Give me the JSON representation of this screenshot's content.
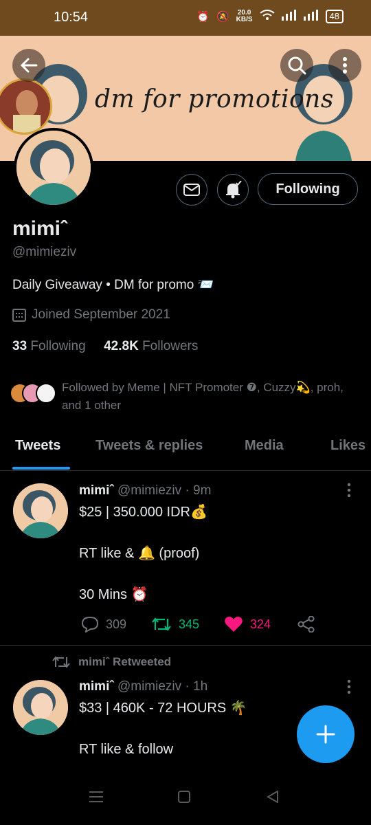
{
  "status_bar": {
    "time": "10:54",
    "net_speed_value": "20.0",
    "net_speed_unit": "KB/S",
    "battery": "48"
  },
  "banner": {
    "text": "dm for promotions"
  },
  "header_icons": {
    "back": "back-arrow-icon",
    "search": "search-icon",
    "more": "more-vertical-icon"
  },
  "profile": {
    "display_name": "mimiˆ",
    "handle": "@mimieziv",
    "bio": "Daily Giveaway • DM for promo 📨",
    "joined": "Joined September 2021",
    "following_count": "33",
    "following_label": "Following",
    "followers_count": "42.8K",
    "followers_label": "Followers",
    "followed_by": "Followed by Meme | NFT Promoter ❼, Cuzzy💫, proh, and 1 other",
    "follow_button": "Following"
  },
  "tabs": [
    {
      "label": "Tweets",
      "active": true
    },
    {
      "label": "Tweets & replies"
    },
    {
      "label": "Media"
    },
    {
      "label": "Likes"
    }
  ],
  "tweets": [
    {
      "name": "mimiˆ",
      "meta": "@mimieziv · 9m",
      "lines": [
        "$25 |  350.000 IDR💰",
        "RT like & 🔔 (proof)",
        "30 Mins ⏰"
      ],
      "replies": "309",
      "retweets": "345",
      "likes": "324"
    },
    {
      "retweet_label": "mimiˆ Retweeted",
      "name": "mimiˆ",
      "meta": "@mimieziv · 1h",
      "lines": [
        "$33 | 460K - 72 HOURS 🌴",
        "RT like & follow"
      ]
    }
  ],
  "colors": {
    "accent": "#1d9bf0",
    "retweet": "#00ba7c",
    "like": "#f91880",
    "banner": "#f2c8a6",
    "statusbar": "#6f4a1f"
  }
}
